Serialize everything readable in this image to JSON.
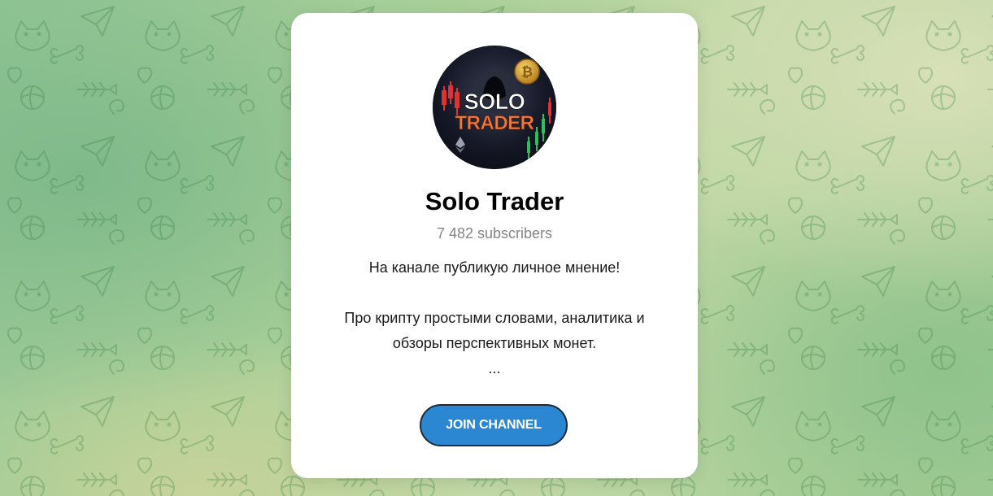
{
  "channel": {
    "name": "Solo Trader",
    "subscribers": "7 482 subscribers",
    "description": {
      "line1": "На канале публикую личное мнение!",
      "line2": "Про крипту простыми словами, аналитика и",
      "line3": "обзоры перспективных монет.",
      "ellipsis": "..."
    },
    "avatar": {
      "text_top": "SOLO",
      "text_bottom": "TRADER",
      "coin_symbol": "₿"
    }
  },
  "actions": {
    "join_label": "JOIN CHANNEL"
  },
  "colors": {
    "button": "#2b87d1",
    "subscribers_text": "#858585",
    "background_green": "#92c596"
  },
  "icons": [
    "background-doodle-pattern",
    "bitcoin-icon",
    "ethereum-icon"
  ]
}
